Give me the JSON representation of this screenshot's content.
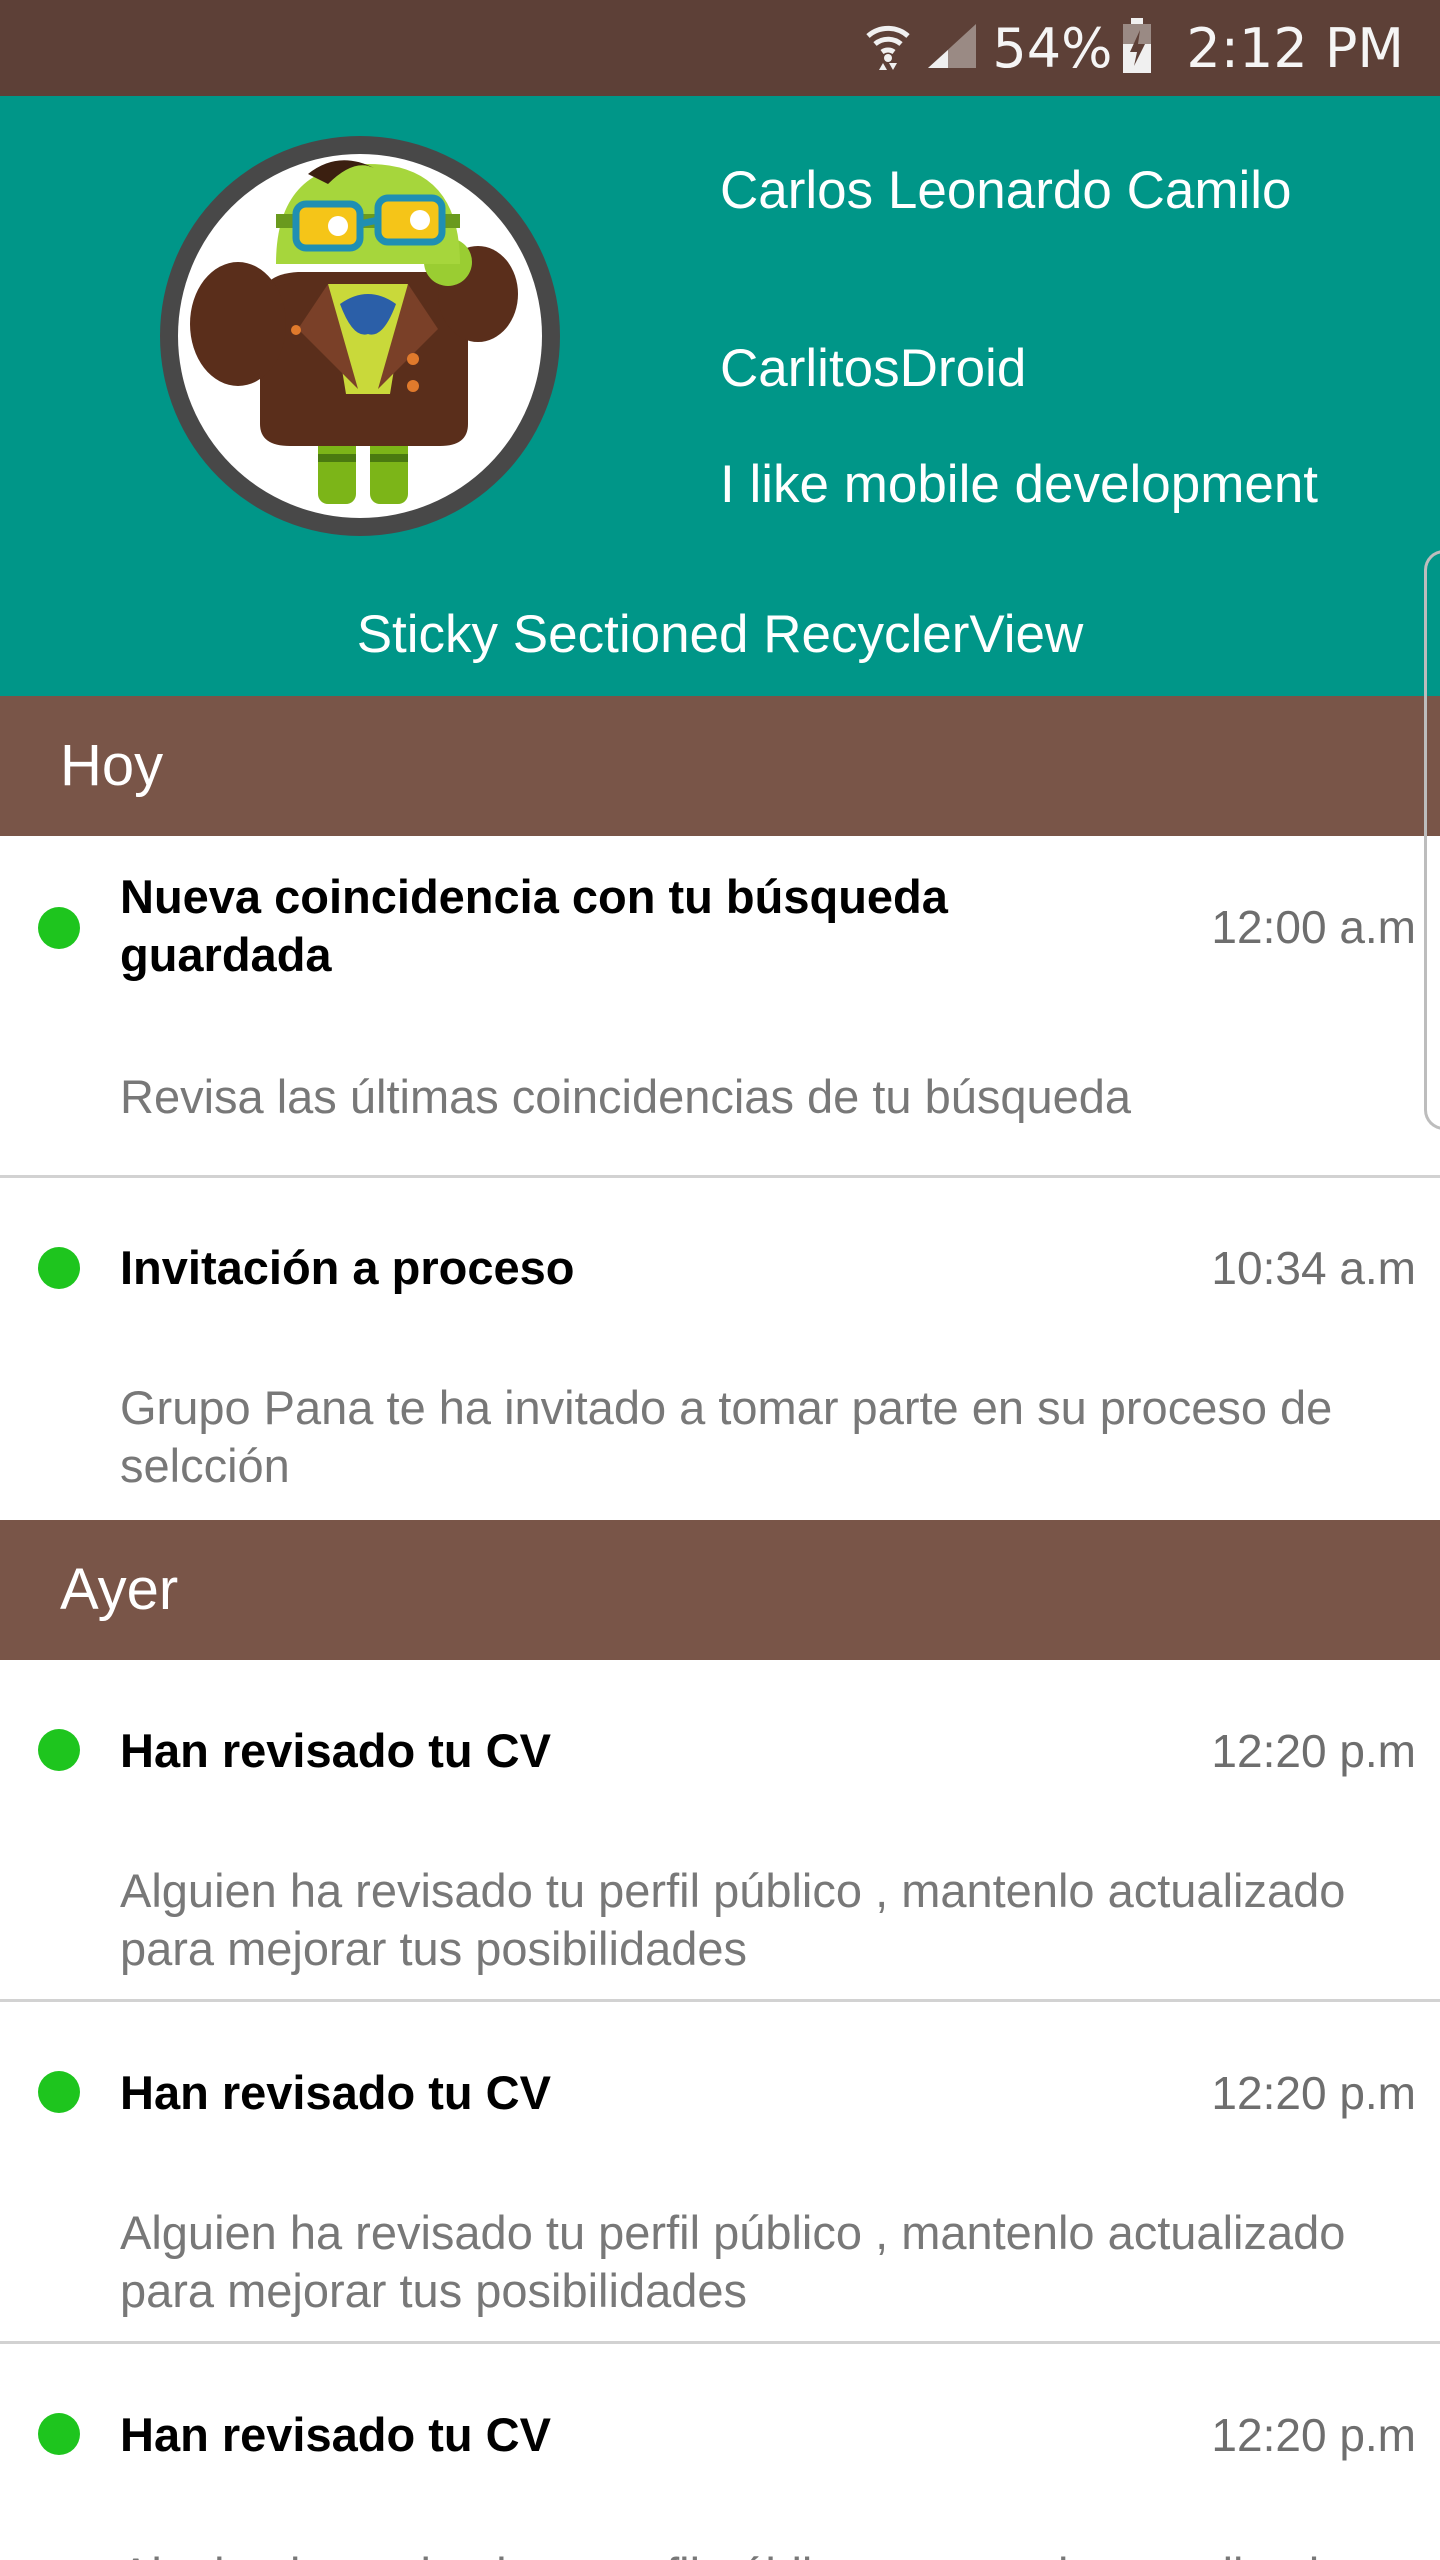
{
  "status_bar": {
    "battery": "54%",
    "time": "2:12 PM",
    "icons": [
      "wifi-icon",
      "signal-icon",
      "battery-charging-icon"
    ]
  },
  "profile": {
    "name": "Carlos Leonardo Camilo",
    "username": "CarlitosDroid",
    "bio": "I like mobile development",
    "caption": "Sticky Sectioned RecyclerView",
    "avatar_icon": "android-robot-avatar"
  },
  "sections": [
    {
      "label": "Hoy",
      "items": [
        {
          "title": "Nueva coincidencia con tu búsqueda guardada",
          "time": "12:00 a.m",
          "description": "Revisa las últimas coincidencias de tu búsqueda"
        },
        {
          "title": "Invitación a proceso",
          "time": "10:34 a.m",
          "description": "Grupo Pana te ha invitado a tomar parte en su proceso de selcción"
        }
      ]
    },
    {
      "label": "Ayer",
      "items": [
        {
          "title": "Han revisado tu CV",
          "time": "12:20 p.m",
          "description": "Alguien ha revisado tu perfil público , mantenlo actualizado para mejorar tus posibilidades"
        },
        {
          "title": "Han revisado tu CV",
          "time": "12:20 p.m",
          "description": "Alguien ha revisado tu perfil público , mantenlo actualizado para mejorar tus posibilidades"
        },
        {
          "title": "Han revisado tu CV",
          "time": "12:20 p.m",
          "description": "Alguien ha revisado tu perfil público , mantenlo actualizado para mejorar tus posibilidades"
        }
      ]
    }
  ],
  "colors": {
    "status_bar": "#5d4037",
    "header": "#009688",
    "section_header": "#795548",
    "unread_dot": "#1ec51e"
  }
}
